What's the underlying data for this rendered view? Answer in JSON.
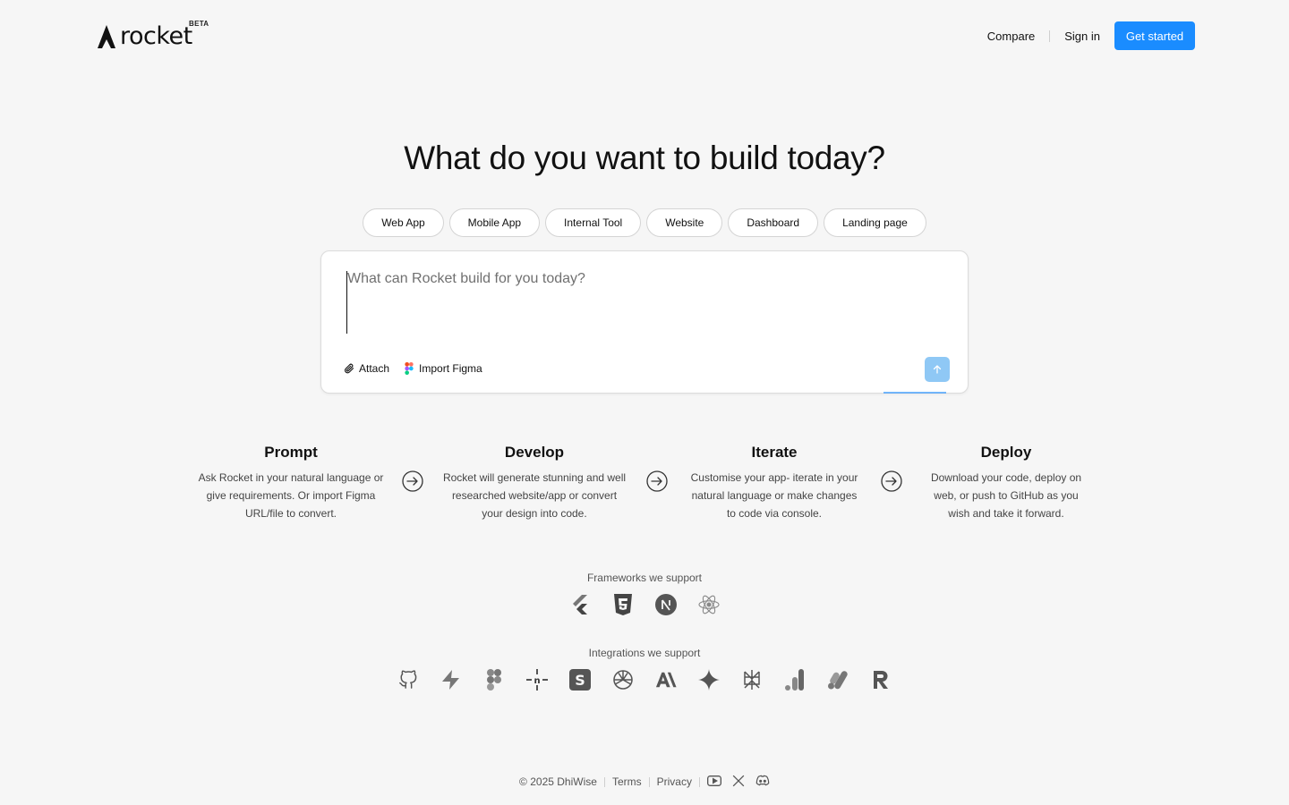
{
  "header": {
    "logo_text": "rocket",
    "beta_badge": "BETA",
    "nav": {
      "compare": "Compare",
      "sign_in": "Sign in",
      "get_started": "Get started"
    }
  },
  "hero": {
    "title": "What do you want to build today?",
    "chips": [
      "Web App",
      "Mobile App",
      "Internal Tool",
      "Website",
      "Dashboard",
      "Landing page"
    ]
  },
  "prompt": {
    "placeholder": "What can Rocket build for you today?",
    "value": "",
    "attach_label": "Attach",
    "import_figma_label": "Import Figma"
  },
  "steps": [
    {
      "title": "Prompt",
      "lines": [
        "Ask Rocket in your natural language or",
        "give requirements. Or import Figma",
        "URL/file to convert."
      ]
    },
    {
      "title": "Develop",
      "lines": [
        "Rocket will generate stunning and well",
        "researched website/app or convert",
        "your design into code."
      ]
    },
    {
      "title": "Iterate",
      "lines": [
        "Customise your app- iterate in your",
        "natural language or make changes",
        "to code via console."
      ]
    },
    {
      "title": "Deploy",
      "lines": [
        "Download your code, deploy on",
        "web, or push to GitHub as you",
        "wish and take it forward."
      ]
    }
  ],
  "frameworks": {
    "label": "Frameworks we support",
    "icons": [
      "flutter-icon",
      "html5-icon",
      "nextjs-icon",
      "react-icon"
    ]
  },
  "integrations": {
    "label": "Integrations we support",
    "icons": [
      "github-icon",
      "supabase-icon",
      "figma-icon",
      "n8n-icon",
      "stripe-icon",
      "openai-icon",
      "anthropic-icon",
      "gemini-icon",
      "perplexity-icon",
      "google-analytics-icon",
      "google-ads-icon",
      "resend-icon"
    ]
  },
  "footer": {
    "copyright": "© 2025 DhiWise",
    "terms": "Terms",
    "privacy": "Privacy",
    "social": [
      "youtube-icon",
      "x-icon",
      "discord-icon"
    ]
  },
  "colors": {
    "accent": "#1a8cff",
    "send_disabled": "#8fc8f5",
    "background": "#f6f6f6"
  }
}
